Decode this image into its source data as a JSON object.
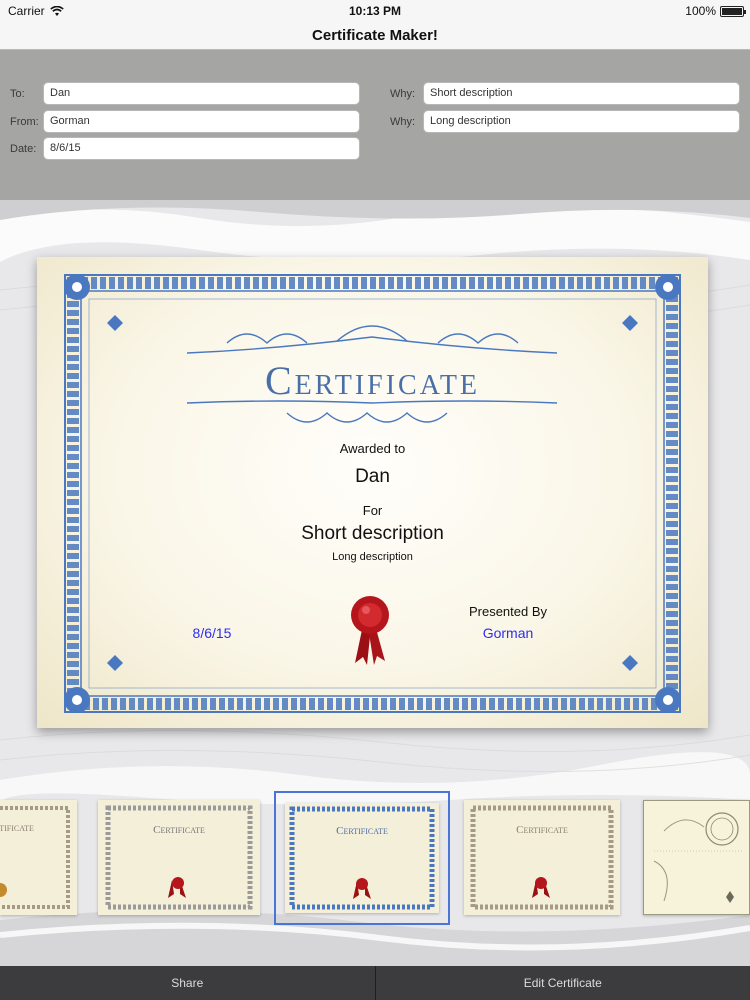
{
  "status": {
    "carrier": "Carrier",
    "time": "10:13 PM",
    "battery": "100%",
    "battery_level": 1.0
  },
  "nav": {
    "title": "Certificate Maker!"
  },
  "form": {
    "to": {
      "label": "To:",
      "value": "Dan"
    },
    "from": {
      "label": "From:",
      "value": "Gorman"
    },
    "date": {
      "label": "Date:",
      "value": "8/6/15"
    },
    "why_short": {
      "label": "Why:",
      "value": "Short description"
    },
    "why_long": {
      "label": "Why:",
      "value": "Long description"
    }
  },
  "certificate": {
    "title": "Certificate",
    "awarded_to_label": "Awarded to",
    "recipient": "Dan",
    "for_label": "For",
    "short_description": "Short description",
    "long_description": "Long description",
    "date": "8/6/15",
    "presented_by_label": "Presented By",
    "presenter": "Gorman",
    "border_color": "#4a78c0",
    "seal_color": "#b5161b"
  },
  "carousel": {
    "thumb_title": "Certificate",
    "selected_index": 2,
    "accent": "#4a74d8"
  },
  "bottom_bar": {
    "share": "Share",
    "edit": "Edit Certificate"
  }
}
